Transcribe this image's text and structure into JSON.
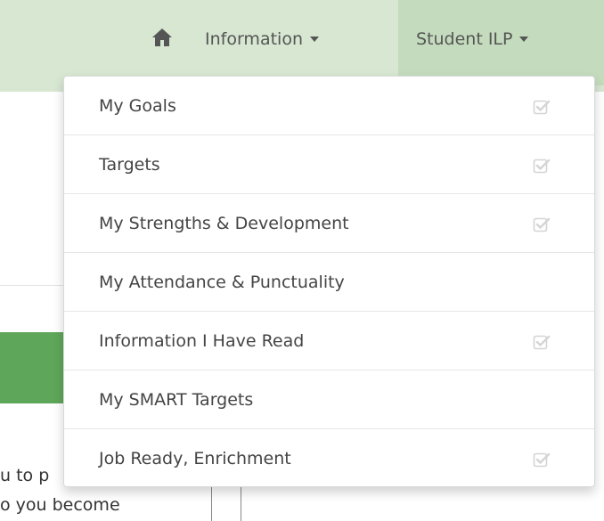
{
  "colors": {
    "navbar_bg": "#d7e7d2",
    "active_tab_bg": "#c4dcbd",
    "band_green": "#5ea65a",
    "text": "#444444",
    "check_icon": "#d4d4d4"
  },
  "navbar": {
    "home_icon": "home-icon",
    "items": [
      {
        "label": "Information",
        "has_caret": true
      },
      {
        "label": "Student ILP",
        "has_caret": true,
        "active": true
      }
    ]
  },
  "dropdown": {
    "items": [
      {
        "label": "My Goals",
        "checked": true
      },
      {
        "label": "Targets",
        "checked": true
      },
      {
        "label": "My Strengths & Development",
        "checked": true
      },
      {
        "label": "My Attendance & Punctuality",
        "checked": false
      },
      {
        "label": "Information I Have Read",
        "checked": true
      },
      {
        "label": "My SMART Targets",
        "checked": false
      },
      {
        "label": "Job Ready, Enrichment",
        "checked": true
      }
    ]
  },
  "background": {
    "text_line_1": "u to p",
    "text_line_2": "o you become"
  }
}
